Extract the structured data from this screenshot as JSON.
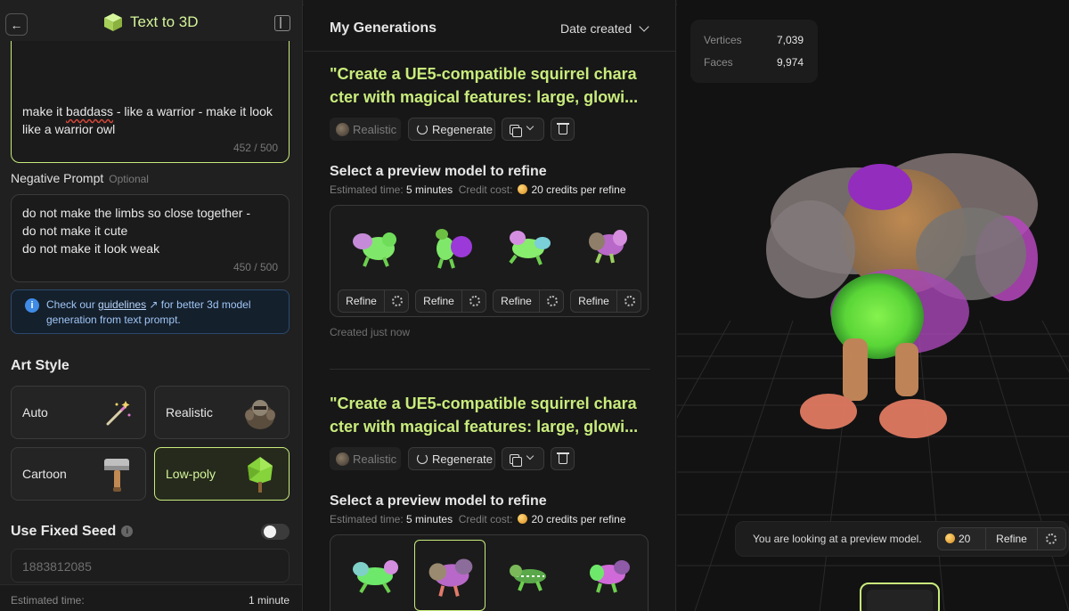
{
  "left_panel": {
    "title": "Text to 3D",
    "prompt": {
      "text_part1": "make it ",
      "text_misspelled": "baddass",
      "text_part2": " - like a warrior - make it look like a warrior owl",
      "count": "452 / 500"
    },
    "negative_prompt": {
      "label": "Negative Prompt",
      "optional": "Optional",
      "text": "do not make the limbs so close together -\ndo not make it cute\ndo not make it look weak",
      "count": "450 / 500"
    },
    "info": {
      "before": "Check our ",
      "link": "guidelines",
      "after": " for better 3d model generation from text prompt."
    },
    "art_style": {
      "heading": "Art Style",
      "options": [
        "Auto",
        "Realistic",
        "Cartoon",
        "Low-poly"
      ],
      "selected": "Low-poly"
    },
    "seed": {
      "heading": "Use Fixed Seed",
      "value": "1883812085",
      "enabled": false
    },
    "estimated": {
      "label": "Estimated time:",
      "value": "1 minute"
    }
  },
  "generations": {
    "heading": "My Generations",
    "sort_label": "Date created",
    "items": [
      {
        "title_line1": "\"Create a UE5-compatible squirrel chara",
        "title_line2": "cter with magical features: large, glowi...",
        "style": "Realistic",
        "regenerate": "Regenerate",
        "select_heading": "Select a preview model to refine",
        "est_label": "Estimated time:",
        "est_value": "5 minutes",
        "cost_label": "Credit cost:",
        "cost_value": "20 credits per refine",
        "refine_label": "Refine",
        "created": "Created just now"
      },
      {
        "title_line1": "\"Create a UE5-compatible squirrel chara",
        "title_line2": "cter with magical features: large, glowi...",
        "style": "Realistic",
        "regenerate": "Regenerate",
        "select_heading": "Select a preview model to refine",
        "est_label": "Estimated time:",
        "est_value": "5 minutes",
        "cost_label": "Credit cost:",
        "cost_value": "20 credits per refine"
      }
    ]
  },
  "viewer": {
    "stats": [
      {
        "label": "Vertices",
        "value": "7,039"
      },
      {
        "label": "Faces",
        "value": "9,974"
      }
    ],
    "preview_message": "You are looking at a preview model.",
    "credits": "20",
    "refine_label": "Refine"
  },
  "colors": {
    "accent": "#c9ec7c",
    "panel": "#202020",
    "info": "#3f8be6"
  }
}
